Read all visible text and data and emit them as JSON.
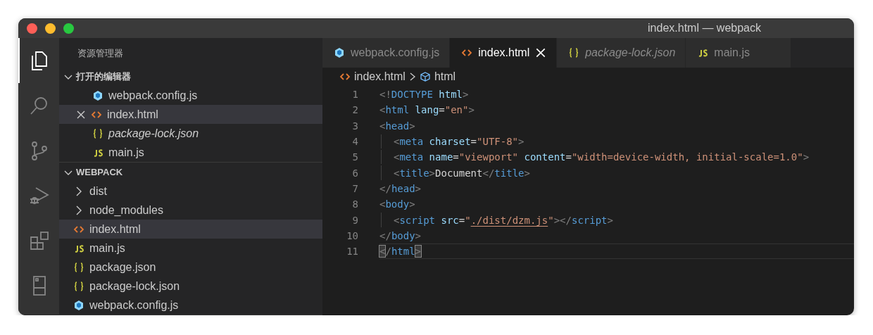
{
  "window": {
    "title": "index.html — webpack"
  },
  "activity_bar": [
    {
      "kind": "files",
      "selected": true
    },
    {
      "kind": "search",
      "selected": false
    },
    {
      "kind": "git",
      "selected": false
    },
    {
      "kind": "debug",
      "selected": false
    },
    {
      "kind": "extensions",
      "selected": false
    },
    {
      "kind": "remote",
      "selected": false
    }
  ],
  "sidebar": {
    "title": "资源管理器",
    "sections": [
      {
        "title": "打开的编辑器",
        "expanded": true,
        "items": [
          {
            "kind": "webpack",
            "label": "webpack.config.js",
            "selected": false,
            "italic": false,
            "close": false
          },
          {
            "kind": "html",
            "label": "index.html",
            "selected": true,
            "italic": false,
            "close": true
          },
          {
            "kind": "json",
            "label": "package-lock.json",
            "selected": false,
            "italic": true,
            "close": false
          },
          {
            "kind": "js",
            "label": "main.js",
            "selected": false,
            "italic": false,
            "close": false
          }
        ]
      },
      {
        "title": "WEBPACK",
        "expanded": true,
        "items": [
          {
            "kind": "folder",
            "label": "dist",
            "selected": false,
            "italic": false,
            "close": false
          },
          {
            "kind": "folder",
            "label": "node_modules",
            "selected": false,
            "italic": false,
            "close": false
          },
          {
            "kind": "html",
            "label": "index.html",
            "selected": true,
            "italic": false,
            "close": false
          },
          {
            "kind": "js",
            "label": "main.js",
            "selected": false,
            "italic": false,
            "close": false
          },
          {
            "kind": "json",
            "label": "package.json",
            "selected": false,
            "italic": false,
            "close": false
          },
          {
            "kind": "json",
            "label": "package-lock.json",
            "selected": false,
            "italic": false,
            "close": false
          },
          {
            "kind": "webpack",
            "label": "webpack.config.js",
            "selected": false,
            "italic": false,
            "close": false
          }
        ]
      }
    ]
  },
  "tabs": [
    {
      "kind": "webpack",
      "label": "webpack.config.js",
      "selected": false,
      "italic": false
    },
    {
      "kind": "html",
      "label": "index.html",
      "selected": true,
      "italic": false
    },
    {
      "kind": "json",
      "label": "package-lock.json",
      "selected": false,
      "italic": true
    },
    {
      "kind": "js",
      "label": "main.js",
      "selected": false,
      "italic": false
    }
  ],
  "breadcrumb": [
    {
      "kind": "html",
      "label": "index.html"
    },
    {
      "kind": "element",
      "label": "html"
    }
  ],
  "code": [
    {
      "number": "1",
      "indent": false,
      "current": false,
      "link": false,
      "bracket_match": false,
      "text": "<!DOCTYPE html>"
    },
    {
      "number": "2",
      "indent": false,
      "current": false,
      "link": false,
      "bracket_match": false,
      "text": "<html lang=\"en\">"
    },
    {
      "number": "3",
      "indent": false,
      "current": false,
      "link": false,
      "bracket_match": false,
      "text": "<head>"
    },
    {
      "number": "4",
      "indent": true,
      "current": false,
      "link": false,
      "bracket_match": false,
      "text": "<meta charset=\"UTF-8\">"
    },
    {
      "number": "5",
      "indent": true,
      "current": false,
      "link": false,
      "bracket_match": false,
      "text": "<meta name=\"viewport\" content=\"width=device-width, initial-scale=1.0\">"
    },
    {
      "number": "6",
      "indent": true,
      "current": false,
      "link": false,
      "bracket_match": false,
      "text": "<title>Document</title>"
    },
    {
      "number": "7",
      "indent": false,
      "current": false,
      "link": false,
      "bracket_match": false,
      "text": "</head>"
    },
    {
      "number": "8",
      "indent": false,
      "current": false,
      "link": false,
      "bracket_match": false,
      "text": "<body>"
    },
    {
      "number": "9",
      "indent": true,
      "current": false,
      "link": true,
      "bracket_match": false,
      "text": "<script src=\"./dist/dzm.js\"></script>"
    },
    {
      "number": "10",
      "indent": false,
      "current": false,
      "link": false,
      "bracket_match": false,
      "text": "</body>"
    },
    {
      "number": "11",
      "indent": false,
      "current": true,
      "link": false,
      "bracket_match": true,
      "text": "</html>"
    }
  ]
}
